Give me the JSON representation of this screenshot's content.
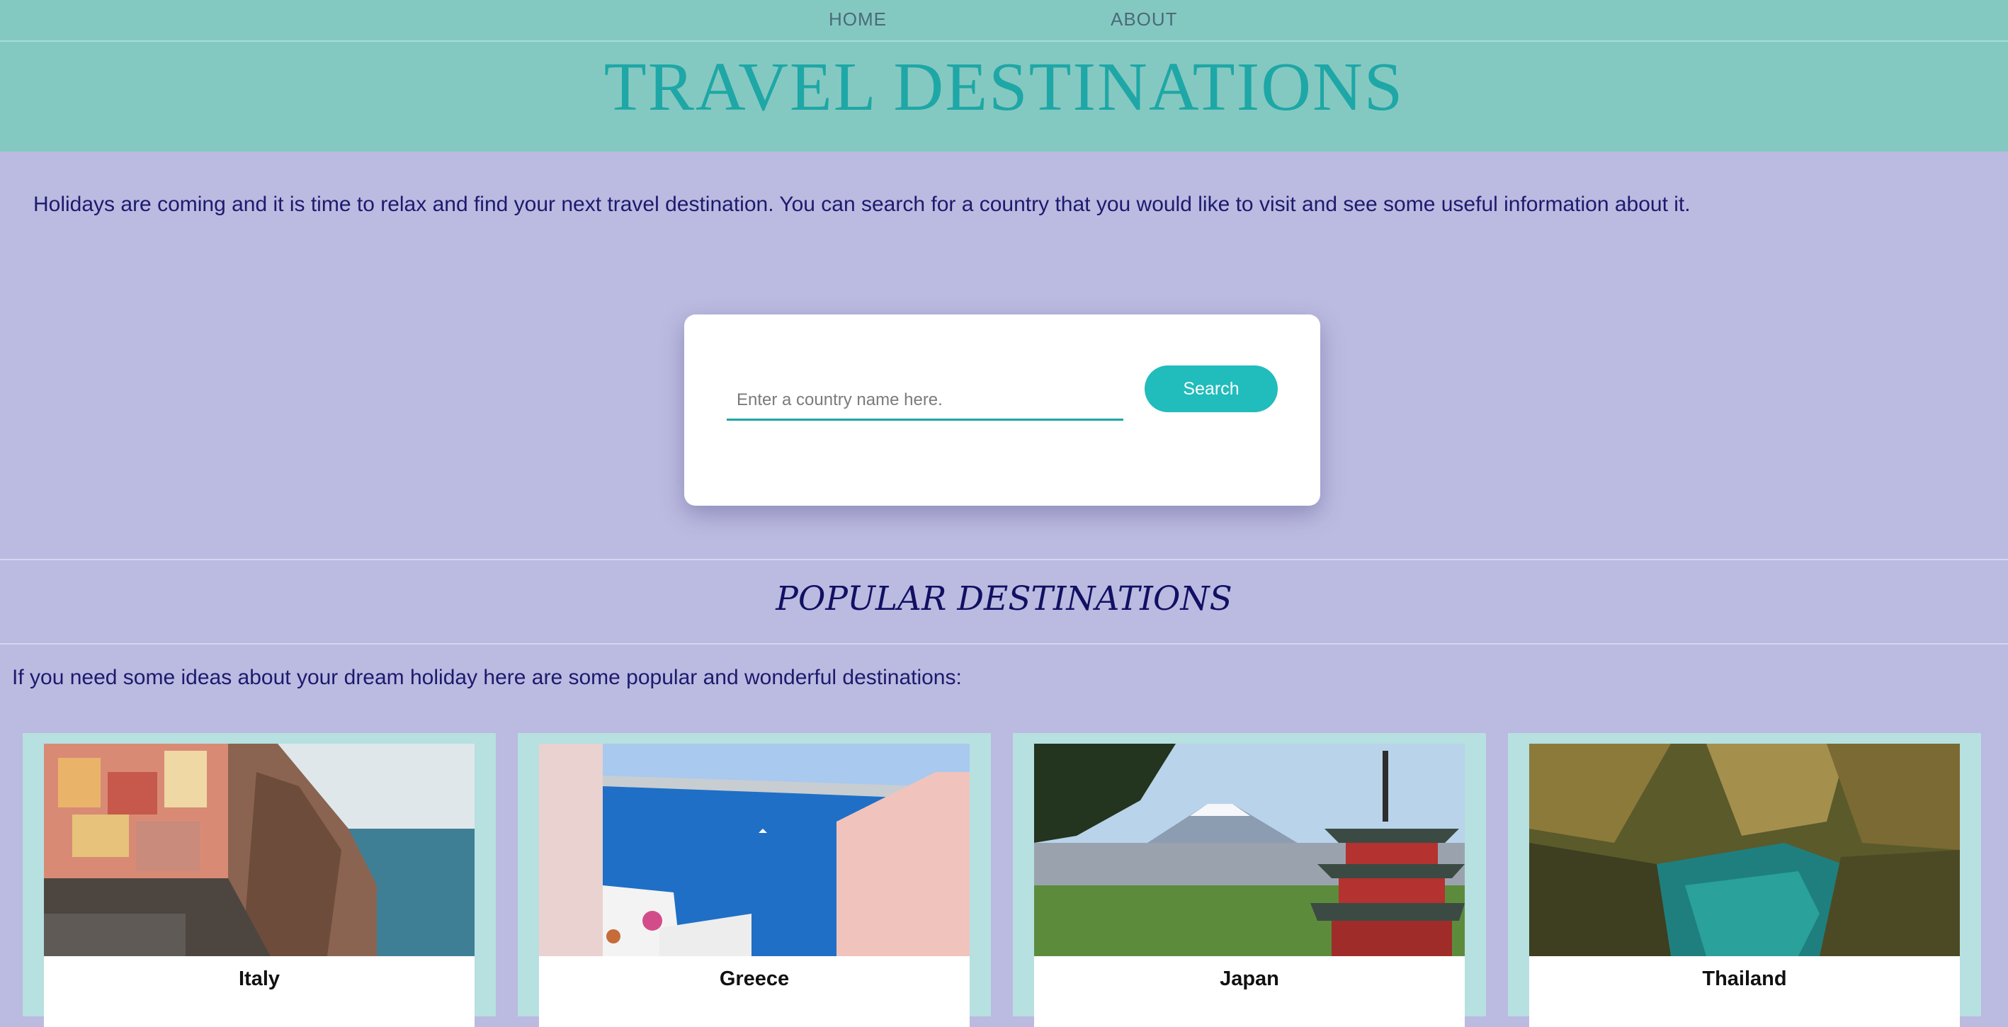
{
  "nav": {
    "home": "HOME",
    "about": "ABOUT"
  },
  "header": {
    "title": "TRAVEL DESTINATIONS"
  },
  "intro": "Holidays are coming and it is time to relax and find your next travel destination. You can search for a country that you would like to visit and see some useful information about it.",
  "search": {
    "placeholder": "Enter a country name here.",
    "value": "",
    "button": "Search"
  },
  "popular": {
    "title": "POPULAR DESTINATIONS",
    "intro": "If you need some ideas about your dream holiday here are some popular and wonderful destinations:",
    "cards": [
      {
        "name": "Italy"
      },
      {
        "name": "Greece"
      },
      {
        "name": "Japan"
      },
      {
        "name": "Thailand"
      }
    ]
  },
  "colors": {
    "nav_bg": "#84c9c1",
    "title": "#1ea7a6",
    "page_bg": "#bbbae0",
    "accent": "#21bcbc",
    "text": "#1d1a6e"
  }
}
